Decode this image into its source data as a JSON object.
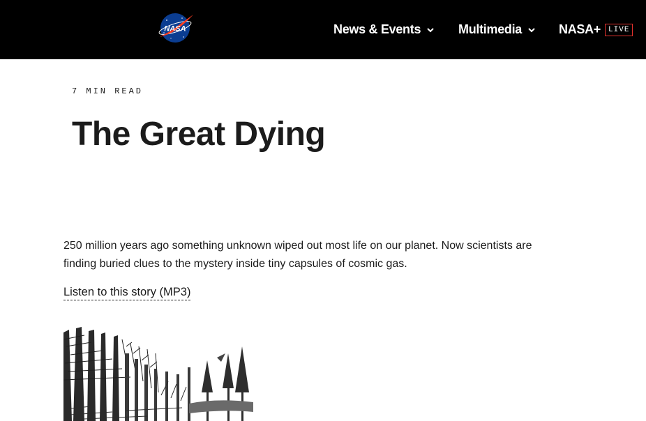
{
  "header": {
    "logo_text": "NASA",
    "nav": [
      {
        "label": "News & Events",
        "has_dropdown": true
      },
      {
        "label": "Multimedia",
        "has_dropdown": true
      },
      {
        "label": "NASA+",
        "badge": "LIVE"
      }
    ],
    "accent_color": "#e3312d",
    "background_color": "#000000"
  },
  "article": {
    "read_time": "7 MIN READ",
    "title": "The Great Dying",
    "lead": "250 million years ago something unknown wiped out most life on our planet. Now scientists are finding buried clues to the mystery inside tiny capsules of cosmic gas.",
    "audio_link": "Listen to this story (MP3)"
  }
}
